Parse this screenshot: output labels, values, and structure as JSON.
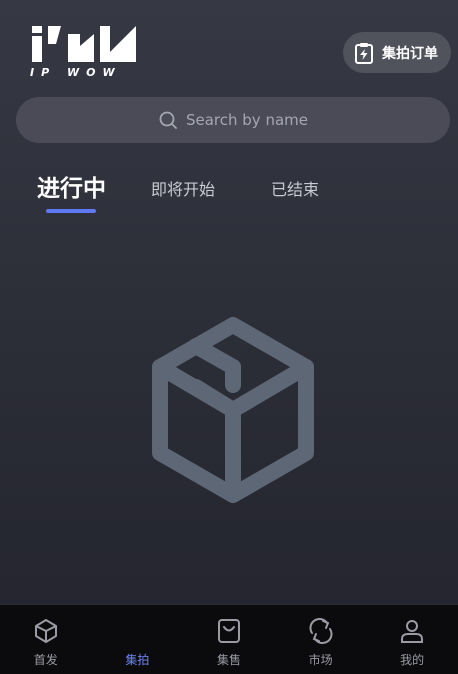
{
  "header": {
    "logo_text": "IP WOW",
    "logo_sub": "IP WOW",
    "order_button_label": "集拍订单"
  },
  "search": {
    "placeholder": "Search by name"
  },
  "tabs": [
    {
      "label": "进行中",
      "active": true
    },
    {
      "label": "即将开始",
      "active": false
    },
    {
      "label": "已结束",
      "active": false
    }
  ],
  "empty_state": {
    "icon": "box-icon"
  },
  "bottom_nav": [
    {
      "label": "首发",
      "icon": "box-icon",
      "active": false
    },
    {
      "label": "集拍",
      "icon": "auction-icon",
      "active": true
    },
    {
      "label": "集售",
      "icon": "bag-icon",
      "active": false
    },
    {
      "label": "市场",
      "icon": "refresh-icon",
      "active": false
    },
    {
      "label": "我的",
      "icon": "user-icon",
      "active": false
    }
  ],
  "colors": {
    "accent": "#5d79f4",
    "active_nav": "#6f84f7",
    "empty_icon": "#5e6776"
  }
}
